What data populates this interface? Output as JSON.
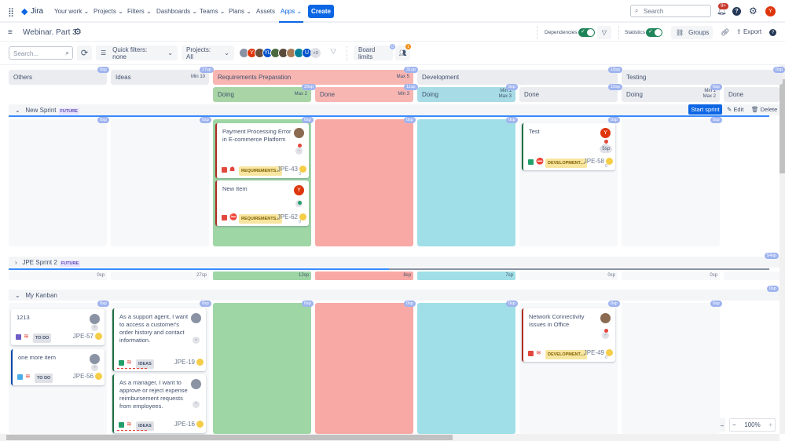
{
  "nav": {
    "logo": "Jira",
    "items": [
      "Your work",
      "Projects",
      "Filters",
      "Dashboards",
      "Teams",
      "Plans",
      "Assets",
      "Apps"
    ],
    "create": "Create",
    "search_placeholder": "Search",
    "notif_badge": "9+",
    "user_initial": "Y"
  },
  "board": {
    "title": "Webinar. Part 3",
    "dependencies_label": "Dependencies",
    "statistics_label": "Statistics",
    "groups": "Groups",
    "export": "Export"
  },
  "toolbar": {
    "search_placeholder": "Search...",
    "quick_filters": "Quick filters: none",
    "projects": "Projects: All",
    "more_avatars": "+3",
    "board_limits": "Board limits",
    "board_limits_badge": "0",
    "groups_badge": "1"
  },
  "columns": [
    {
      "name": "Others",
      "sp": "0sp"
    },
    {
      "name": "Ideas",
      "limit": "Min 10",
      "sp": "27sp"
    },
    {
      "name": "Requirements Preparation",
      "limit": "Max 5",
      "sp": "31sp"
    },
    {
      "name": "Development",
      "sp": "18sp"
    },
    {
      "name": "Testing",
      "sp": "0sp"
    }
  ],
  "subcolumns": [
    {
      "name": "Doing",
      "limit": "Max 2",
      "sp": "20sp"
    },
    {
      "name": "Done",
      "limit": "Min 3",
      "sp": "11sp"
    },
    {
      "name": "Doing",
      "limit": "Min 1\nMax 3",
      "sp": "8sp"
    },
    {
      "name": "Done",
      "sp": "10sp"
    },
    {
      "name": "Doing",
      "limit": "Min 1\nMax 2",
      "sp": "0sp"
    },
    {
      "name": "Done",
      "sp": ""
    }
  ],
  "lanes": {
    "sprint1": {
      "name": "New Sprint",
      "tag": "FUTURE",
      "start": "Start sprint",
      "edit": "Edit",
      "delete": "Delete",
      "cell_sp": [
        "0sp",
        "0sp",
        "0sp",
        "0sp",
        "0sp",
        "0sp",
        "0sp"
      ]
    },
    "sprint2": {
      "name": "JPE Sprint 2",
      "tag": "FUTURE",
      "sp": "54sp",
      "summary": [
        "0sp",
        "27sp",
        "12sp",
        "8sp",
        "7sp",
        "0sp",
        "0sp"
      ]
    },
    "kanban": {
      "name": "My Kanban",
      "sp": "0sp",
      "cell_sp": [
        "0sp",
        "0sp",
        "0sp",
        "0sp",
        "0sp",
        "0sp",
        "0sp"
      ]
    }
  },
  "cards": [
    {
      "title": "Payment Processing Error in E-commerce Platform",
      "label": "REQUIREMENTS...",
      "key": "JPE-43",
      "extra": "3"
    },
    {
      "title": "New Item",
      "label": "REQUIREMENTS...",
      "key": "JPE-62",
      "avatar": "Y",
      "extra": "0"
    },
    {
      "title": "Test",
      "label": "DEVELOPMENT....",
      "key": "JPE-58",
      "avatar": "Y",
      "estimate": "5sp",
      "extra": "0"
    },
    {
      "title": "1213",
      "label": "TO DO",
      "key": "JPE-57"
    },
    {
      "title": "one more item",
      "label": "TO DO",
      "key": "JPE-56"
    },
    {
      "title": "As a support agent, I want to access a customer's order history and contact information.",
      "label": "IDEAS",
      "key": "JPE-19"
    },
    {
      "title": "As a manager, I want to approve or reject expense reimbursement requests from employees.",
      "label": "IDEAS",
      "key": "JPE-16"
    },
    {
      "title": "Network Connectivity Issues in Office",
      "label": "DEVELOPMENT....",
      "key": "JPE-49",
      "extra": "0"
    }
  ],
  "zoom": {
    "level": "100%",
    "minus": "−",
    "plus": "+"
  },
  "colors": {
    "accent": "#0c66e4",
    "green": "#9fd6a6",
    "red": "#f8a9a5",
    "cyan": "#a0dfe7",
    "toggle": "#1f845a"
  }
}
